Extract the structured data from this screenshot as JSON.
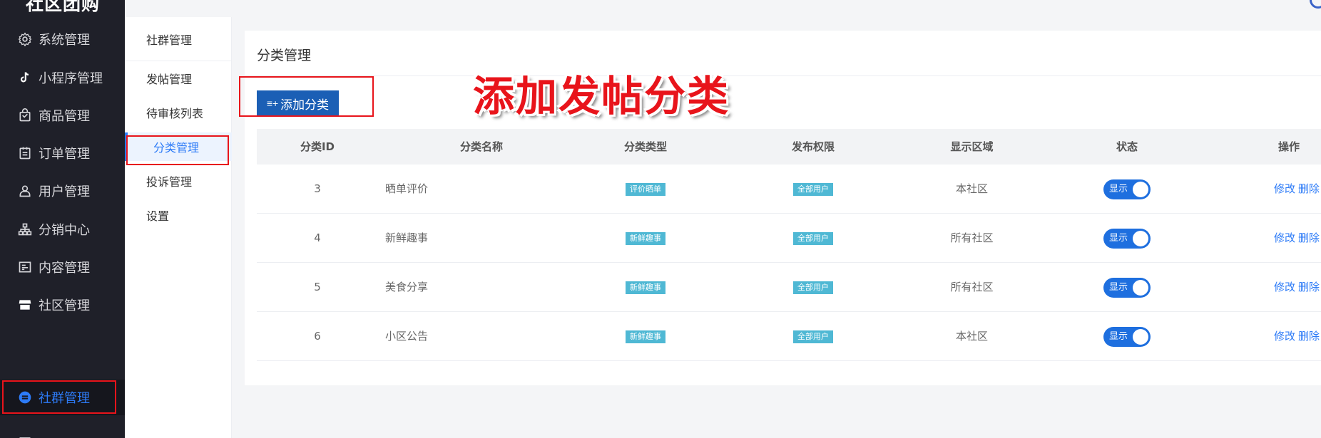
{
  "app": {
    "logo_text": "社区团购"
  },
  "sidebar": {
    "items": [
      {
        "label": "系统管理",
        "icon": "gear-icon"
      },
      {
        "label": "小程序管理",
        "icon": "tiktok-icon"
      },
      {
        "label": "商品管理",
        "icon": "bag-icon"
      },
      {
        "label": "订单管理",
        "icon": "clipboard-icon"
      },
      {
        "label": "用户管理",
        "icon": "user-icon"
      },
      {
        "label": "分销中心",
        "icon": "org-chart-icon"
      },
      {
        "label": "内容管理",
        "icon": "article-icon"
      },
      {
        "label": "社区管理",
        "icon": "store-icon"
      },
      {
        "label": "社群管理",
        "icon": "group-icon"
      }
    ],
    "active_index": 8
  },
  "submenu": {
    "header": "社群管理",
    "items": [
      {
        "label": "发帖管理"
      },
      {
        "label": "待审核列表"
      },
      {
        "label": "分类管理"
      },
      {
        "label": "投诉管理"
      },
      {
        "label": "设置"
      }
    ],
    "active_index": 2
  },
  "main": {
    "title": "分类管理",
    "add_button": "添加分类",
    "overlay_text": "添加发帖分类"
  },
  "table": {
    "headers": [
      "分类ID",
      "分类名称",
      "分类类型",
      "发布权限",
      "显示区域",
      "状态",
      "操作"
    ],
    "rows": [
      {
        "id": "3",
        "name": "晒单评价",
        "type": "评价晒单",
        "perm": "全部用户",
        "area": "本社区",
        "status": "显示"
      },
      {
        "id": "4",
        "name": "新鲜趣事",
        "type": "新鲜趣事",
        "perm": "全部用户",
        "area": "所有社区",
        "status": "显示"
      },
      {
        "id": "5",
        "name": "美食分享",
        "type": "新鲜趣事",
        "perm": "全部用户",
        "area": "所有社区",
        "status": "显示"
      },
      {
        "id": "6",
        "name": "小区公告",
        "type": "新鲜趣事",
        "perm": "全部用户",
        "area": "本社区",
        "status": "显示"
      }
    ],
    "edit_label": "修改",
    "delete_label": "删除"
  },
  "colors": {
    "accent": "#2d7bf7",
    "highlight": "#e8141b",
    "button": "#1b5fb5",
    "tag": "#4fb8d4"
  }
}
